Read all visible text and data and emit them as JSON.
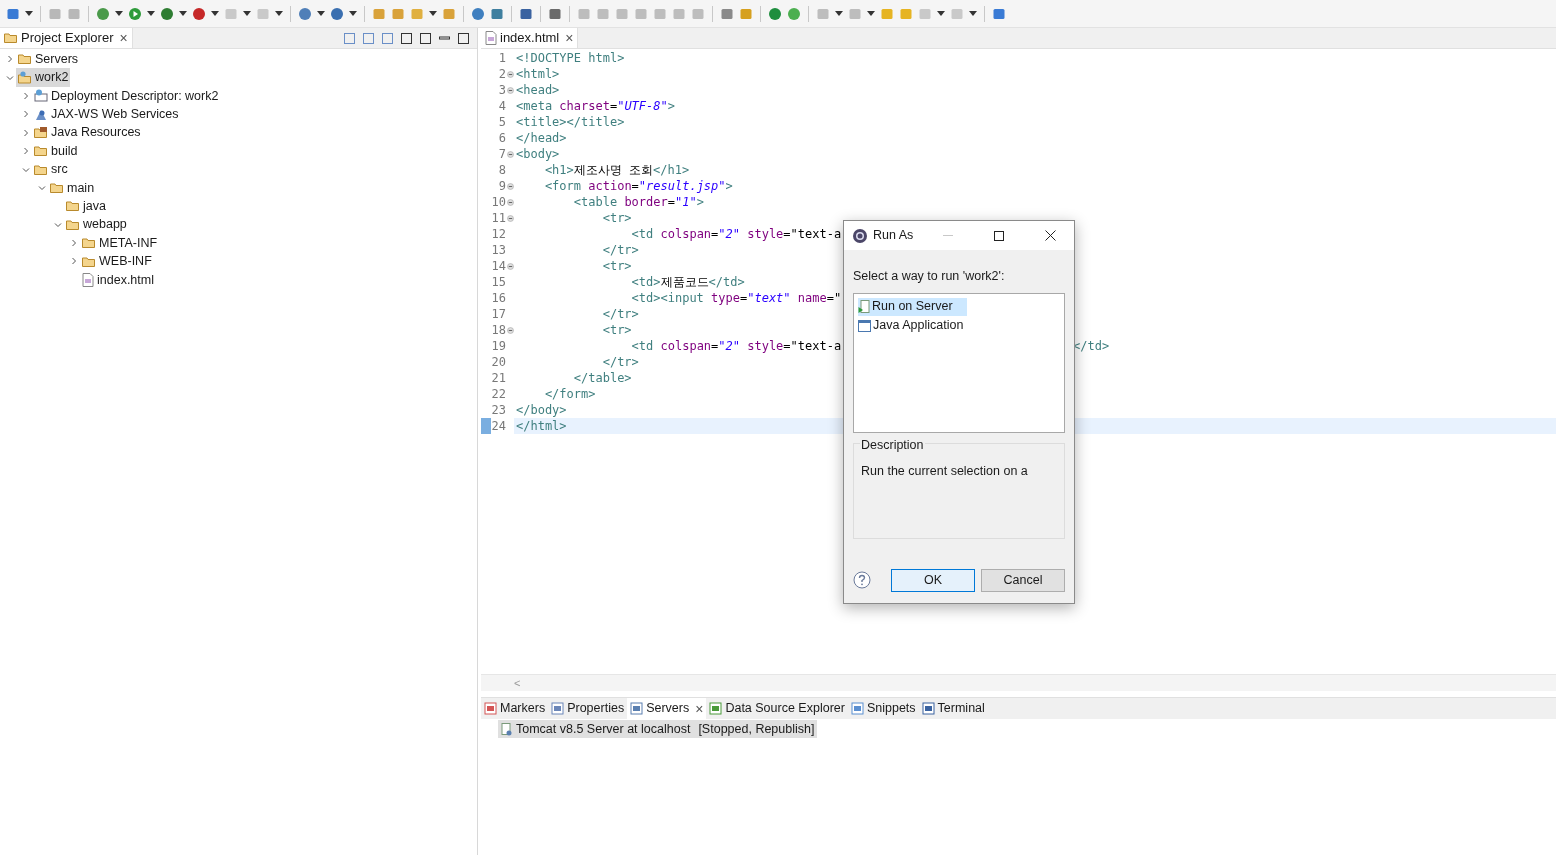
{
  "explorer": {
    "title": "Project Explorer",
    "close": "×",
    "tree": [
      {
        "label": "Servers",
        "kind": "folder",
        "expanded": false,
        "selected": false
      },
      {
        "label": "work2",
        "kind": "project",
        "expanded": true,
        "selected": true,
        "children": [
          {
            "label": "Deployment Descriptor: work2",
            "kind": "descriptor",
            "expanded": false,
            "selected": false
          },
          {
            "label": "JAX-WS Web Services",
            "kind": "webservices",
            "expanded": false,
            "selected": false
          },
          {
            "label": "Java Resources",
            "kind": "resources",
            "expanded": false,
            "selected": false
          },
          {
            "label": "build",
            "kind": "folder",
            "expanded": false,
            "selected": false
          },
          {
            "label": "src",
            "kind": "folder",
            "expanded": true,
            "selected": false,
            "children": [
              {
                "label": "main",
                "kind": "folder",
                "expanded": true,
                "selected": false,
                "children": [
                  {
                    "label": "java",
                    "kind": "folder",
                    "selected": false
                  },
                  {
                    "label": "webapp",
                    "kind": "folder",
                    "expanded": true,
                    "selected": false,
                    "children": [
                      {
                        "label": "META-INF",
                        "kind": "folder",
                        "expanded": false,
                        "selected": false
                      },
                      {
                        "label": "WEB-INF",
                        "kind": "folder",
                        "expanded": false,
                        "selected": false
                      },
                      {
                        "label": "index.html",
                        "kind": "file",
                        "selected": false
                      }
                    ]
                  }
                ]
              }
            ]
          }
        ]
      }
    ]
  },
  "editor": {
    "tab": "index.html",
    "close": "×",
    "lines": [
      {
        "number": "1",
        "foldable": false,
        "current": false,
        "tokens": [
          {
            "kind": "tag",
            "text": "<!DOCTYPE html>"
          }
        ]
      },
      {
        "number": "2",
        "foldable": true,
        "current": false,
        "tokens": [
          {
            "kind": "tag",
            "text": "<html>"
          }
        ]
      },
      {
        "number": "3",
        "foldable": true,
        "current": false,
        "tokens": [
          {
            "kind": "tag",
            "text": "<head>"
          }
        ]
      },
      {
        "number": "4",
        "foldable": false,
        "current": false,
        "tokens": [
          {
            "kind": "tag",
            "text": "<meta"
          },
          {
            "kind": "attr",
            "text": " charset"
          },
          {
            "kind": "plain",
            "text": "="
          },
          {
            "kind": "str",
            "text": "\"UTF-8\""
          },
          {
            "kind": "tag",
            "text": ">"
          }
        ]
      },
      {
        "number": "5",
        "foldable": false,
        "current": false,
        "tokens": [
          {
            "kind": "tag",
            "text": "<title></title>"
          }
        ]
      },
      {
        "number": "6",
        "foldable": false,
        "current": false,
        "tokens": [
          {
            "kind": "tag",
            "text": "</head>"
          }
        ]
      },
      {
        "number": "7",
        "foldable": true,
        "current": false,
        "tokens": [
          {
            "kind": "tag",
            "text": "<body>"
          }
        ]
      },
      {
        "number": "8",
        "foldable": false,
        "current": false,
        "tokens": [
          {
            "kind": "tag",
            "text": "    <h1>"
          },
          {
            "kind": "plain",
            "text": "제조사명 조회"
          },
          {
            "kind": "tag",
            "text": "</h1>"
          }
        ]
      },
      {
        "number": "9",
        "foldable": true,
        "current": false,
        "tokens": [
          {
            "kind": "tag",
            "text": "    <form"
          },
          {
            "kind": "attr",
            "text": " action"
          },
          {
            "kind": "plain",
            "text": "="
          },
          {
            "kind": "str",
            "text": "\"result.jsp\""
          },
          {
            "kind": "tag",
            "text": ">"
          }
        ]
      },
      {
        "number": "10",
        "foldable": true,
        "current": false,
        "tokens": [
          {
            "kind": "tag",
            "text": "        <table"
          },
          {
            "kind": "attr",
            "text": " border"
          },
          {
            "kind": "plain",
            "text": "="
          },
          {
            "kind": "str",
            "text": "\"1\""
          },
          {
            "kind": "tag",
            "text": ">"
          }
        ]
      },
      {
        "number": "11",
        "foldable": true,
        "current": false,
        "tokens": [
          {
            "kind": "tag",
            "text": "            <tr>"
          }
        ]
      },
      {
        "number": "12",
        "foldable": false,
        "current": false,
        "tokens": [
          {
            "kind": "tag",
            "text": "                <td"
          },
          {
            "kind": "attr",
            "text": " colspan"
          },
          {
            "kind": "plain",
            "text": "="
          },
          {
            "kind": "str",
            "text": "\"2\""
          },
          {
            "kind": "attr",
            "text": " style"
          },
          {
            "kind": "plain",
            "text": "=\"text-a"
          }
        ]
      },
      {
        "number": "13",
        "foldable": false,
        "current": false,
        "tokens": [
          {
            "kind": "tag",
            "text": "            </tr>"
          }
        ]
      },
      {
        "number": "14",
        "foldable": true,
        "current": false,
        "tokens": [
          {
            "kind": "tag",
            "text": "            <tr>"
          }
        ]
      },
      {
        "number": "15",
        "foldable": false,
        "current": false,
        "tokens": [
          {
            "kind": "tag",
            "text": "                <td>"
          },
          {
            "kind": "plain",
            "text": "제품코드"
          },
          {
            "kind": "tag",
            "text": "</td>"
          }
        ]
      },
      {
        "number": "16",
        "foldable": false,
        "current": false,
        "tokens": [
          {
            "kind": "tag",
            "text": "                <td><input"
          },
          {
            "kind": "attr",
            "text": " type"
          },
          {
            "kind": "plain",
            "text": "="
          },
          {
            "kind": "str",
            "text": "\"text\""
          },
          {
            "kind": "attr",
            "text": " name"
          },
          {
            "kind": "plain",
            "text": "=\""
          }
        ]
      },
      {
        "number": "17",
        "foldable": false,
        "current": false,
        "tokens": [
          {
            "kind": "tag",
            "text": "            </tr>"
          }
        ]
      },
      {
        "number": "18",
        "foldable": true,
        "current": false,
        "tokens": [
          {
            "kind": "tag",
            "text": "            <tr>"
          }
        ]
      },
      {
        "number": "19",
        "foldable": false,
        "current": false,
        "tokens": [
          {
            "kind": "tag",
            "text": "                <td"
          },
          {
            "kind": "attr",
            "text": " colspan"
          },
          {
            "kind": "plain",
            "text": "="
          },
          {
            "kind": "str",
            "text": "\"2\""
          },
          {
            "kind": "attr",
            "text": " style"
          },
          {
            "kind": "plain",
            "text": "=\"text-a"
          }
        ],
        "tail": "</td>"
      },
      {
        "number": "20",
        "foldable": false,
        "current": false,
        "tokens": [
          {
            "kind": "tag",
            "text": "            </tr>"
          }
        ]
      },
      {
        "number": "21",
        "foldable": false,
        "current": false,
        "tokens": [
          {
            "kind": "tag",
            "text": "        </table>"
          }
        ]
      },
      {
        "number": "22",
        "foldable": false,
        "current": false,
        "tokens": [
          {
            "kind": "tag",
            "text": "    </form>"
          }
        ]
      },
      {
        "number": "23",
        "foldable": false,
        "current": false,
        "tokens": [
          {
            "kind": "tag",
            "text": "</body>"
          }
        ]
      },
      {
        "number": "24",
        "foldable": false,
        "current": true,
        "tokens": [
          {
            "kind": "tag",
            "text": "</html>"
          }
        ]
      }
    ],
    "scroll_left": "<"
  },
  "bottom_panel": {
    "tabs": [
      {
        "label": "Markers",
        "selected": false
      },
      {
        "label": "Properties",
        "selected": false
      },
      {
        "label": "Servers",
        "selected": true,
        "close": "×"
      },
      {
        "label": "Data Source Explorer",
        "selected": false
      },
      {
        "label": "Snippets",
        "selected": false
      },
      {
        "label": "Terminal",
        "selected": false
      }
    ],
    "servers": [
      {
        "name": "Tomcat v8.5 Server at localhost",
        "status": "[Stopped, Republish]",
        "selected": true
      }
    ]
  },
  "dialog": {
    "title": "Run As",
    "prompt": "Select a way to run 'work2':",
    "options": [
      {
        "label": "Run on Server",
        "kind": "server",
        "selected": true
      },
      {
        "label": "Java Application",
        "kind": "java",
        "selected": false
      }
    ],
    "description_label": "Description",
    "description": "Run the current selection on a",
    "buttons": [
      {
        "label": "OK",
        "default": true
      },
      {
        "label": "Cancel",
        "default": false
      }
    ]
  }
}
